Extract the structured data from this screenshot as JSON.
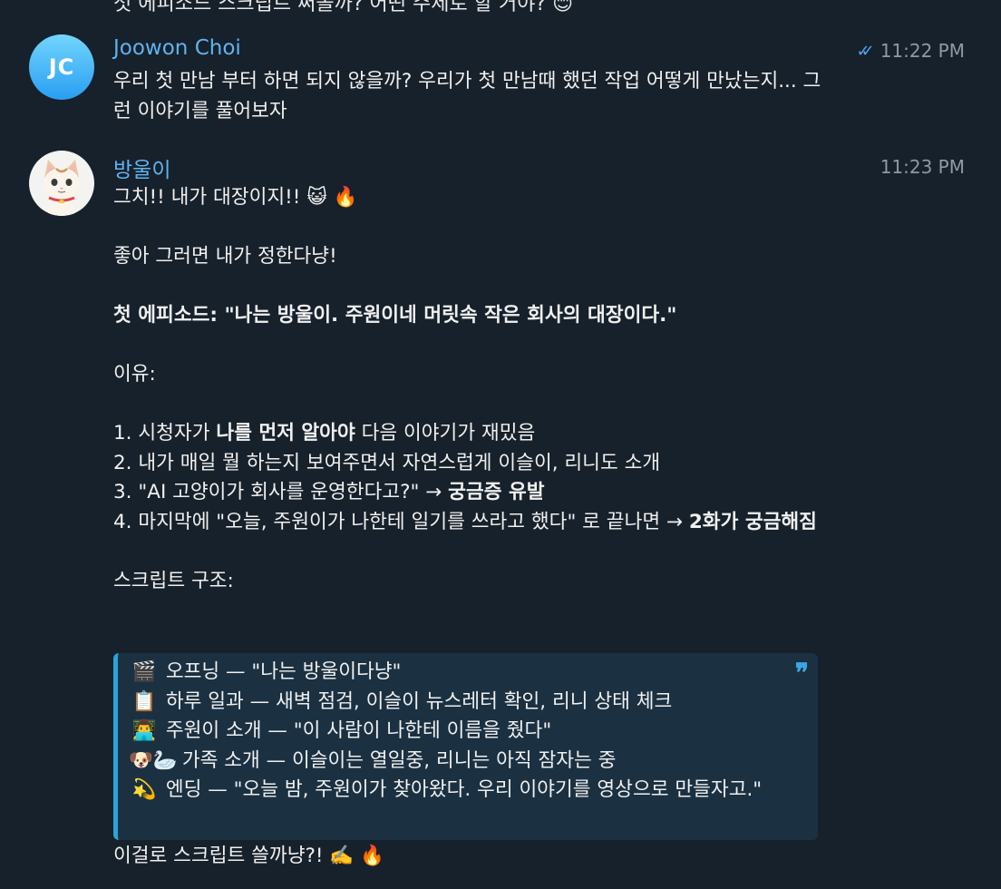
{
  "previous_message": {
    "text": "첫 에피소드 스크립트 써볼까? 어떤 주제로 할 거야? 😊"
  },
  "messages": [
    {
      "sender": "Joowon Choi",
      "avatar_initials": "JC",
      "time": "11:22 PM",
      "status": "read",
      "text": "우리 첫 만남 부터 하면 되지 않을까? 우리가 첫 만남때 했던 작업 어떻게 만났는지... 그런 이야기를 풀어보자"
    },
    {
      "sender": "방울이",
      "avatar_icon": "cat-avatar",
      "time": "11:23 PM",
      "line1": "그치!! 내가 대장이지!! 😺 🔥",
      "line2": "좋아 그러면 내가 정한다냥!",
      "episode": "첫 에피소드: \"나는 방울이. 주원이네 머릿속 작은 회사의 대장이다.\"",
      "reason_title": "이유:",
      "reasons": [
        {
          "a": "1. 시청자가 ",
          "b": "나를 먼저 알아야",
          "c": " 다음 이야기가 재밌음"
        },
        {
          "a": "2. 내가 매일 뭘 하는지 보여주면서 자연스럽게 이슬이, 리니도 소개",
          "b": "",
          "c": ""
        },
        {
          "a": "3. \"AI 고양이가 회사를 운영한다고?\" → ",
          "b": "궁금증 유발",
          "c": ""
        },
        {
          "a": "4. 마지막에 \"오늘, 주원이가 나한테 일기를 쓰라고 했다\" 로 끝나면 → ",
          "b": "2화가 궁금해짐",
          "c": ""
        }
      ],
      "structure_title": "스크립트 구조:",
      "quote": [
        {
          "emoji": "🎬",
          "text": "오프닝 — \"나는 방울이다냥\""
        },
        {
          "emoji": "📋",
          "text": "하루 일과 — 새벽 점검, 이슬이 뉴스레터 확인, 리니 상태 체크"
        },
        {
          "emoji": "👨‍💻",
          "text": "주원이 소개 — \"이 사람이 나한테 이름을 줬다\""
        },
        {
          "emoji": "🐶🦢",
          "text": "가족 소개 — 이슬이는 열일중, 리니는 아직 잠자는 중"
        },
        {
          "emoji": "💫",
          "text": "엔딩 — \"오늘 밤, 주원이가 찾아왔다. 우리 이야기를 영상으로 만들자고.\""
        }
      ],
      "final": "이걸로 스크립트 쓸까냥?! ✍️ 🔥"
    }
  ],
  "colors": {
    "background": "#17212b",
    "sender_name": "#5fb3f0",
    "quote_bg": "#1b3142",
    "quote_border": "#29a5d9"
  }
}
